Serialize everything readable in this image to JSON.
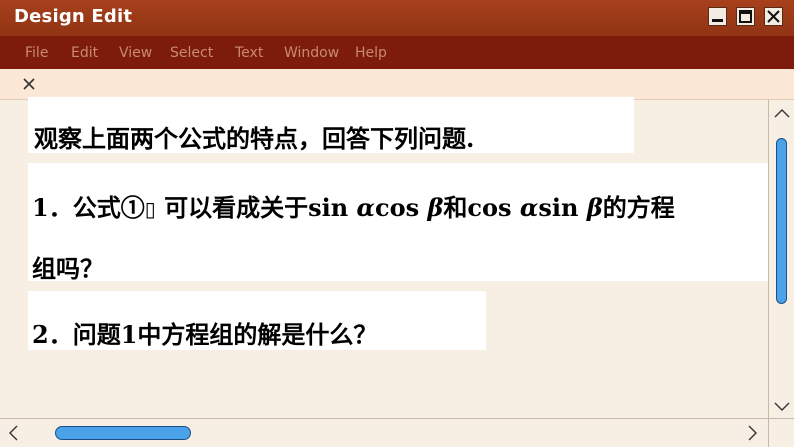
{
  "window": {
    "title": "Design Edit",
    "controls": [
      "minimize-icon",
      "maximize-icon",
      "close-icon"
    ]
  },
  "menu": {
    "items": [
      "File",
      "Edit",
      "View",
      "Select",
      "Text",
      "Window",
      "Help"
    ]
  },
  "tab": {
    "close_icon": "close-icon"
  },
  "document": {
    "line1": "观察上面两个公式的特点，回答下列问题.",
    "line2_prefix": "1．公式①",
    "line2_glyph": "▯",
    "line2_mid": " 可以看成关于sin ",
    "alpha1": "α",
    "cos1": "cos ",
    "beta1": "β",
    "and": "和cos ",
    "alpha2": "α",
    "sin2": "sin ",
    "beta2": "β",
    "line2_suffix": "的方程",
    "line3": "组吗？",
    "line4": "2．问题1中方程组的解是什么？"
  },
  "colors": {
    "titlebar": "#9b3a17",
    "menubar": "#7d1c0c",
    "menu_text": "#c98a72",
    "tabbar": "#fbe8d6",
    "canvas": "#f7efe4",
    "scroll_thumb": "#4aa3e8"
  }
}
